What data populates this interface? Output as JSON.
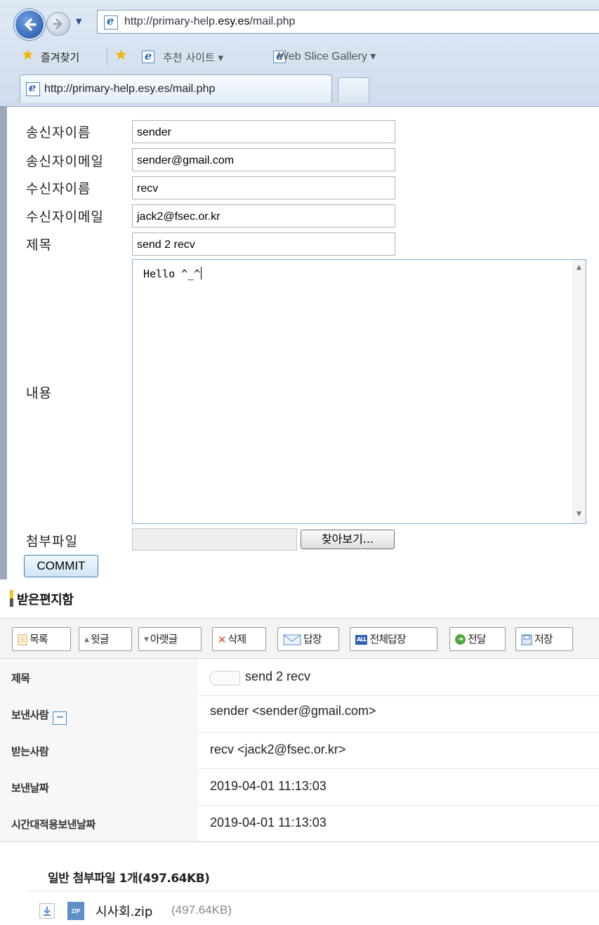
{
  "browser": {
    "url": "http://primary-help.esy.es/mail.php",
    "url_prefix": "http://primary-help.",
    "url_domain": "esy.es",
    "url_suffix": "/mail.php",
    "favorites_label": "즐겨찾기",
    "suggested_sites_label": "추천 사이트 ▾",
    "web_slice_label": "Web Slice Gallery ▾",
    "tab_title": "http://primary-help.esy.es/mail.php"
  },
  "form": {
    "sender_name_label": "송신자이름",
    "sender_name_value": "sender",
    "sender_email_label": "송신자이메일",
    "sender_email_value": "sender@gmail.com",
    "recv_name_label": "수신자이름",
    "recv_name_value": "recv",
    "recv_email_label": "수신자이메일",
    "recv_email_value": "jack2@fsec.or.kr",
    "subject_label": "제목",
    "subject_value": "send 2 recv",
    "content_label": "내용",
    "content_value": "Hello ^_^",
    "attachment_label": "첨부파일",
    "browse_label": "찾아보기...",
    "commit_label": "COMMIT"
  },
  "inbox": {
    "title": "받은편지함",
    "toolbar": [
      "목록",
      "윗글",
      "아랫글",
      "삭제",
      "답장",
      "전체답장",
      "전달",
      "저장"
    ],
    "subject_label": "제목",
    "subject_value": "send 2 recv",
    "from_label": "보낸사람",
    "fold_symbol": "−",
    "from_value": "sender <sender@gmail.com>",
    "to_label": "받는사람",
    "to_value": "recv <jack2@fsec.or.kr>",
    "sent_date_label": "보낸날짜",
    "sent_date_value": "2019-04-01 11:13:03",
    "tz_sent_date_label": "시간대적용보낸날짜",
    "tz_sent_date_value": "2019-04-01 11:13:03",
    "attachment_title": "일반 첨부파일 1개(497.64KB)",
    "attachment_icon_text": "ZIP",
    "attachment_name": "시사회.zip",
    "attachment_size": "(497.64KB)"
  },
  "colors": {
    "link_blue": "#3b82d6",
    "toolbar_bg": "#f4f4f4",
    "inbox_mark": "#f2c230"
  }
}
